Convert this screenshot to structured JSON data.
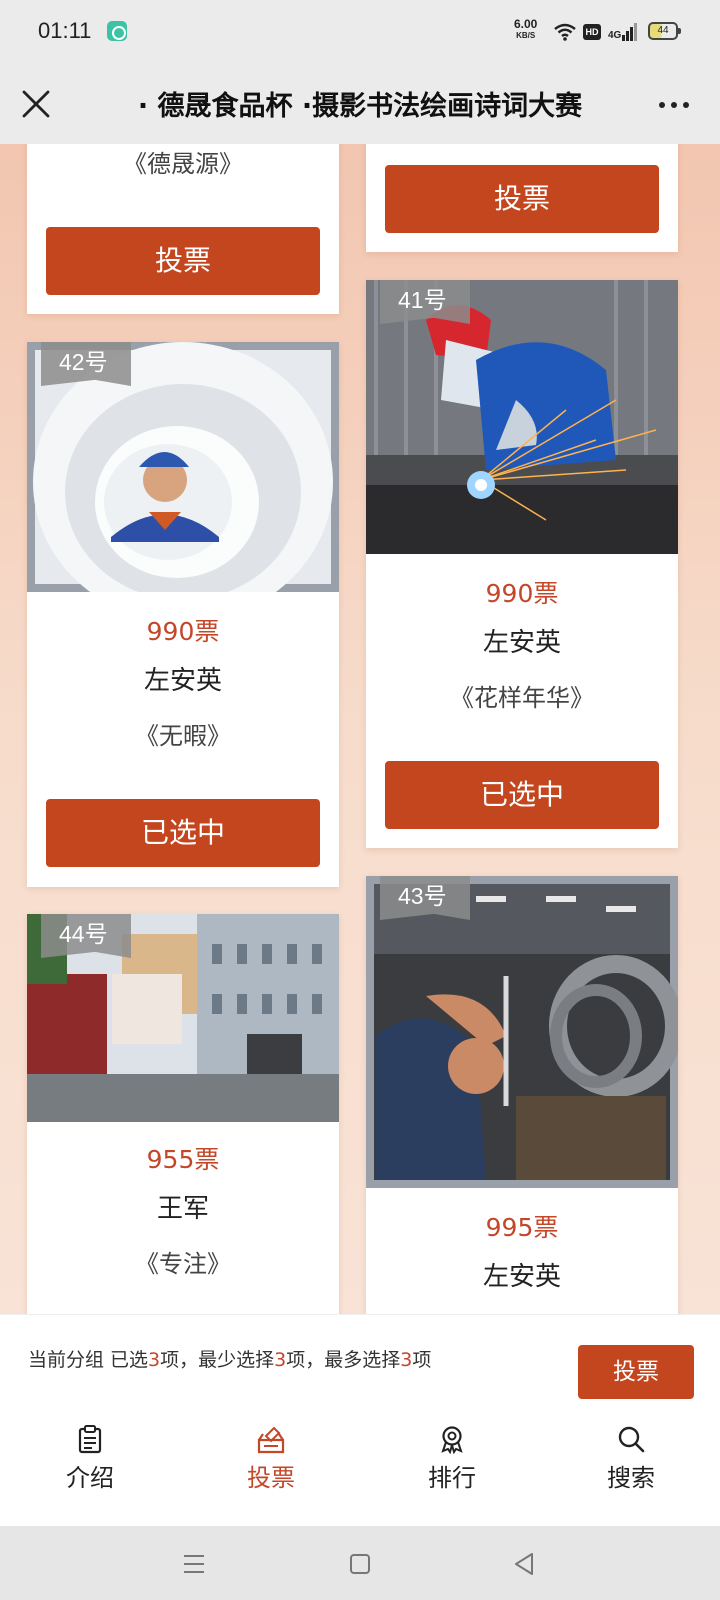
{
  "status_bar": {
    "time": "01:11",
    "speed_value": "6.00",
    "speed_unit": "KB/S",
    "hd": "HD",
    "network": "4G",
    "battery": "44"
  },
  "header": {
    "title": "· 德晟食品杯 ·摄影书法绘画诗词大赛",
    "close_icon": "close-icon",
    "more_icon": "more-icon"
  },
  "cards": [
    {
      "title": "《德晟源》",
      "button": "投票"
    },
    {
      "button": "投票"
    },
    {
      "number": "42号",
      "votes": "990票",
      "author": "左安英",
      "title": "《无暇》",
      "button": "已选中",
      "selected": true
    },
    {
      "number": "41号",
      "votes": "990票",
      "author": "左安英",
      "title": "《花样年华》",
      "button": "已选中",
      "selected": true
    },
    {
      "number": "44号",
      "votes": "955票",
      "author": "王军",
      "title": "《专注》"
    },
    {
      "number": "43号",
      "votes": "995票",
      "author": "左安英"
    }
  ],
  "selection": {
    "p1": "当前分组 已选",
    "n1": "3",
    "p2": "项，最少选择",
    "n2": "3",
    "p3": "项，最多选择",
    "n3": "3",
    "p4": "项",
    "submit": "投票"
  },
  "tabs": [
    {
      "label": "介绍",
      "icon": "clipboard-icon"
    },
    {
      "label": "投票",
      "icon": "ballot-box-icon",
      "active": true
    },
    {
      "label": "排行",
      "icon": "award-icon"
    },
    {
      "label": "搜索",
      "icon": "search-icon"
    }
  ],
  "colors": {
    "accent": "#c4461f",
    "votes_text": "#c4472a",
    "page_background": "#f2c6b0"
  }
}
